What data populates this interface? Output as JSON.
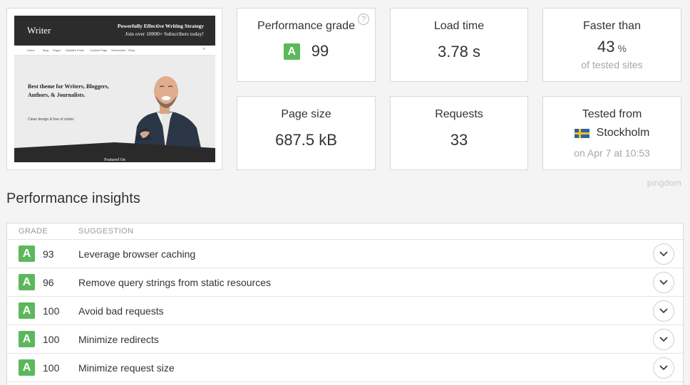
{
  "screenshot": {
    "site_logo": "Writer",
    "tagline_1": "Powerfully Effective Writing Strategy",
    "tagline_2": "Join over 10000+ Subscribers today!",
    "nav": [
      "Home",
      "Blog",
      "Pages",
      "Updates Posts",
      "Contact Page",
      "Shortcodes",
      "Shop"
    ],
    "headline": "Best theme for Writers, Bloggers, Authors, & Journalists.",
    "subhead": "Clean design & free of clutter.",
    "footer_text": "Featured On"
  },
  "metrics": {
    "performance_grade": {
      "label": "Performance grade",
      "grade": "A",
      "value": "99",
      "help": "?"
    },
    "load_time": {
      "label": "Load time",
      "value": "3.78 s"
    },
    "faster_than": {
      "label": "Faster than",
      "value": "43",
      "unit": "%",
      "sub": "of tested sites"
    },
    "page_size": {
      "label": "Page size",
      "value": "687.5 kB"
    },
    "requests": {
      "label": "Requests",
      "value": "33"
    },
    "tested_from": {
      "label": "Tested from",
      "location": "Stockholm",
      "date": "on Apr 7 at 10:53"
    }
  },
  "brand": "pingdom",
  "insights": {
    "title": "Performance insights",
    "columns": {
      "grade": "GRADE",
      "suggestion": "SUGGESTION"
    },
    "rows": [
      {
        "grade": "A",
        "score": "93",
        "suggestion": "Leverage browser caching"
      },
      {
        "grade": "A",
        "score": "96",
        "suggestion": "Remove query strings from static resources"
      },
      {
        "grade": "A",
        "score": "100",
        "suggestion": "Avoid bad requests"
      },
      {
        "grade": "A",
        "score": "100",
        "suggestion": "Minimize redirects"
      },
      {
        "grade": "A",
        "score": "100",
        "suggestion": "Minimize request size"
      }
    ]
  },
  "colors": {
    "grade_a": "#5cb85c",
    "background": "#f4f4f4",
    "flag_blue": "#2e62a8",
    "flag_yellow": "#f6c21c"
  }
}
